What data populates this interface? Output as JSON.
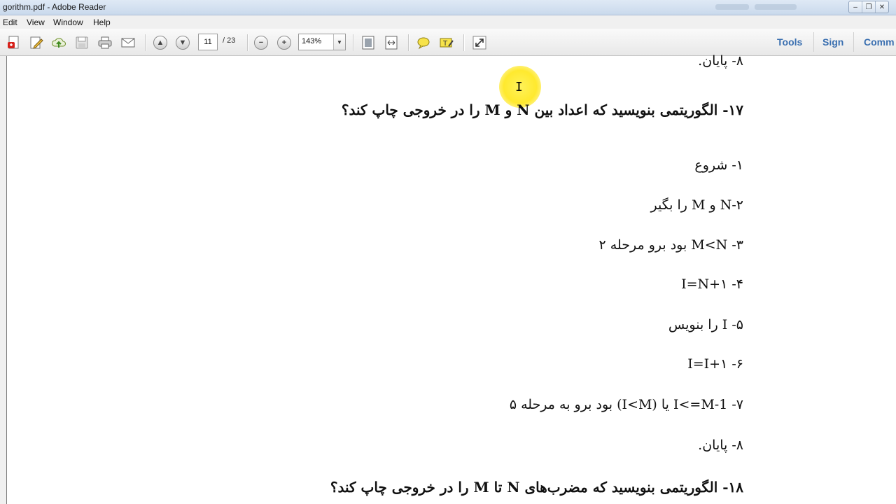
{
  "window": {
    "title": "gorithm.pdf - Adobe Reader"
  },
  "menu": {
    "items": [
      "Edit",
      "View",
      "Window",
      "Help"
    ]
  },
  "toolbar": {
    "page_current": "11",
    "page_total": "/ 23",
    "zoom": "143%",
    "right_links": [
      "Tools",
      "Sign",
      "Comm"
    ]
  },
  "icons": {
    "create": "create-pdf-icon",
    "edit": "edit-icon",
    "upload": "cloud-upload-icon",
    "save": "save-icon",
    "print": "print-icon",
    "email": "email-icon",
    "prev": "arrow-up-icon",
    "next": "arrow-down-icon",
    "zoom_out": "minus-icon",
    "zoom_in": "plus-icon",
    "fit_page": "fit-page-icon",
    "fit_width": "fit-width-icon",
    "comment": "comment-icon",
    "highlight": "highlight-icon",
    "fullscreen": "expand-icon"
  },
  "document": {
    "lines": [
      "۸- پایان.",
      "۱۷- الگوریتمی بنویسید که اعداد بین N و M را در خروجی چاپ کند؟",
      "۱- شروع",
      "۲-N و M را بگیر",
      "۳- M<N بود برو مرحله ۲",
      "۴- I=N+۱",
      "۵- I را بنویس",
      "۶-  I=I+۱",
      "۷- I<=M-1 یا (I<M) بود برو به مرحله ۵",
      "۸- پایان.",
      "۱۸- الگوریتمی بنویسید که مضرب‌های N تا M را در خروجی چاپ کند؟"
    ]
  },
  "colors": {
    "accent": "#3a6fb0",
    "highlight": "#ffe92e"
  }
}
